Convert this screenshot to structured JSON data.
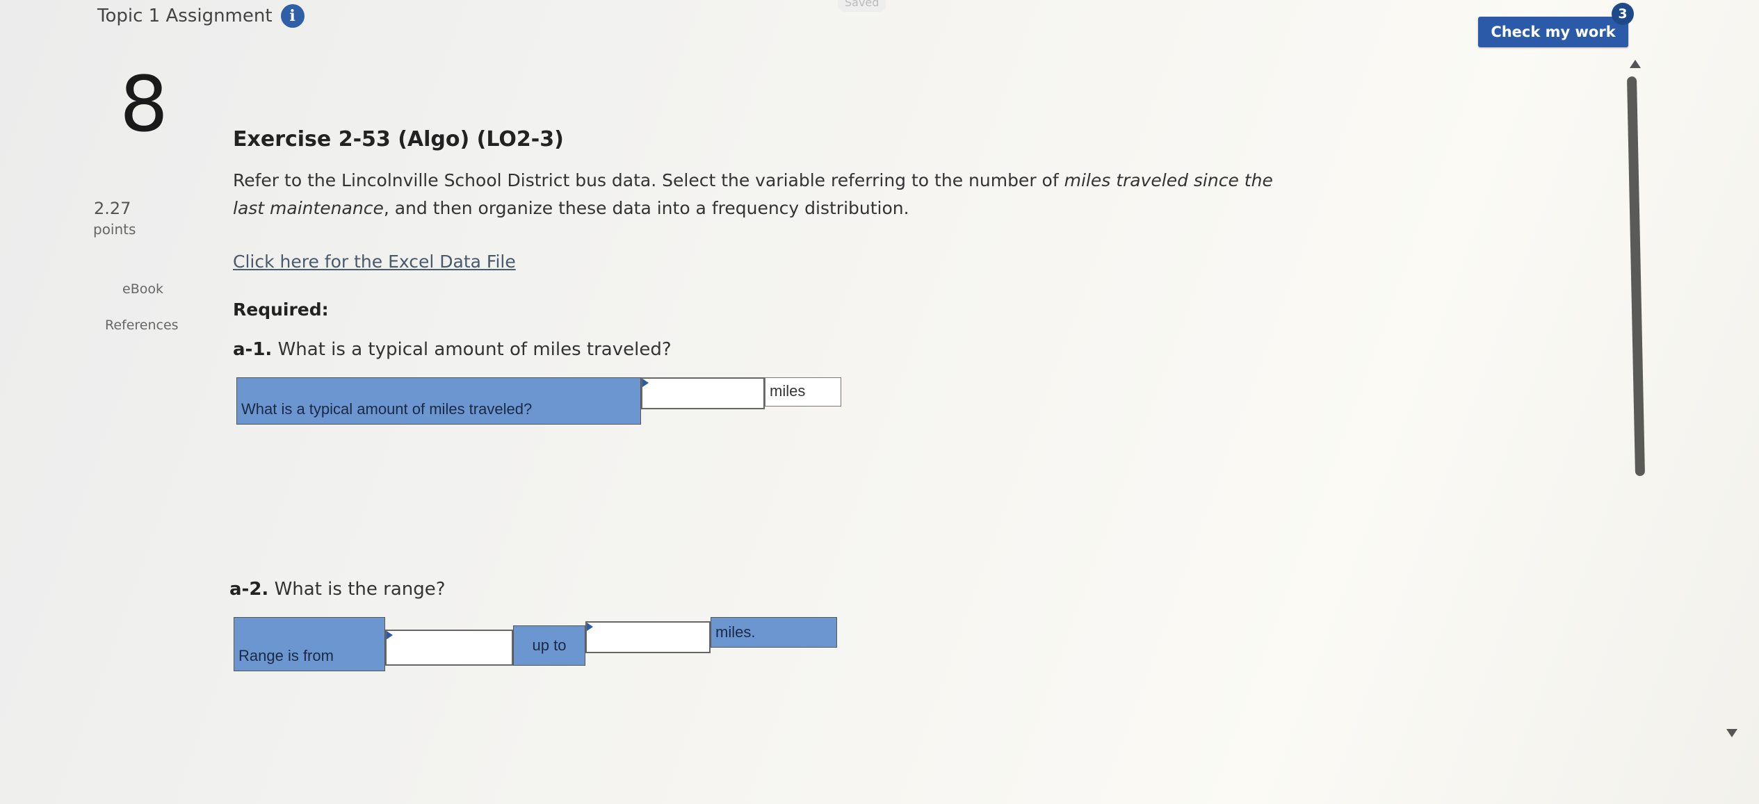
{
  "header": {
    "assignment_title": "Topic 1 Assignment",
    "saved_label": "Saved",
    "check_button_label": "Check my work",
    "check_badge_count": "3"
  },
  "sidebar": {
    "question_number": "8",
    "points_value": "2.27",
    "points_label": "points",
    "ebook_label": "eBook",
    "references_label": "References"
  },
  "exercise": {
    "title": "Exercise 2-53 (Algo) (LO2-3)",
    "prompt_part1": "Refer to the Lincolnville School District bus data. Select the variable referring to the number of ",
    "prompt_italic1": "miles traveled since the last maintenance",
    "prompt_part2": ", and then organize these data into a frequency distribution.",
    "data_link": "Click here for the Excel Data File",
    "required_label": "Required:"
  },
  "q_a1": {
    "label": "a-1.",
    "text": "What is a typical amount of miles traveled?",
    "row_label": "What is a typical amount of miles traveled?",
    "input_value": "",
    "unit": "miles"
  },
  "q_a2": {
    "label": "a-2.",
    "text": "What is the range?",
    "row_label": "Range is from",
    "input_from_value": "",
    "mid_label": "up to",
    "input_to_value": "",
    "unit": "miles."
  },
  "colors": {
    "accent_blue": "#2b5ba8",
    "cell_blue": "#6b96cf"
  }
}
